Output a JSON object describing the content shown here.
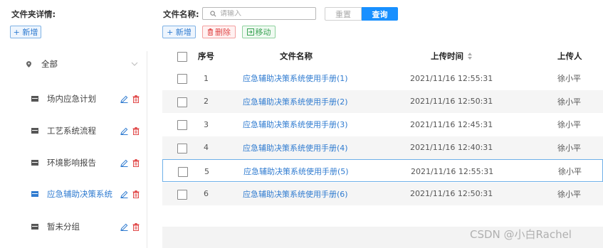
{
  "folder_panel": {
    "title": "文件夹详情:",
    "add_label": "+ 新增"
  },
  "search": {
    "label": "文件名称:",
    "placeholder": "请输入",
    "reset_label": "重置",
    "query_label": "查询"
  },
  "toolbar": {
    "add_label": "+ 新增",
    "delete_label": "删除",
    "move_label": "移动"
  },
  "tree": {
    "root_label": "全部",
    "items": [
      {
        "label": "场内应急计划",
        "active": false
      },
      {
        "label": "工艺系统流程",
        "active": false
      },
      {
        "label": "环境影响报告",
        "active": false
      },
      {
        "label": "应急辅助决策系统",
        "active": true
      },
      {
        "label": "暂未分组",
        "active": false
      }
    ]
  },
  "table": {
    "headers": {
      "index": "序号",
      "name": "文件名称",
      "time": "上传时间",
      "uploader": "上传人"
    },
    "rows": [
      {
        "index": "1",
        "name": "应急辅助决策系统使用手册(1)",
        "time": "2021/11/16 12:55:31",
        "uploader": "徐小平"
      },
      {
        "index": "2",
        "name": "应急辅助决策系统使用手册(2)",
        "time": "2021/11/16 12:50:31",
        "uploader": "徐小平"
      },
      {
        "index": "3",
        "name": "应急辅助决策系统使用手册(3)",
        "time": "2021/11/16 12:45:31",
        "uploader": "徐小平"
      },
      {
        "index": "4",
        "name": "应急辅助决策系统使用手册(4)",
        "time": "2021/11/16 12:40:31",
        "uploader": "徐小平"
      },
      {
        "index": "5",
        "name": "应急辅助决策系统使用手册(5)",
        "time": "2021/11/16 12:55:31",
        "uploader": "徐小平"
      },
      {
        "index": "6",
        "name": "应急辅助决策系统使用手册(6)",
        "time": "2021/11/16 12:50:31",
        "uploader": "徐小平"
      }
    ]
  },
  "watermark": "CSDN @小白Rachel",
  "colors": {
    "accent": "#1890ff",
    "link": "#2f7bd0",
    "danger": "#e04646",
    "success": "#3aa354"
  }
}
